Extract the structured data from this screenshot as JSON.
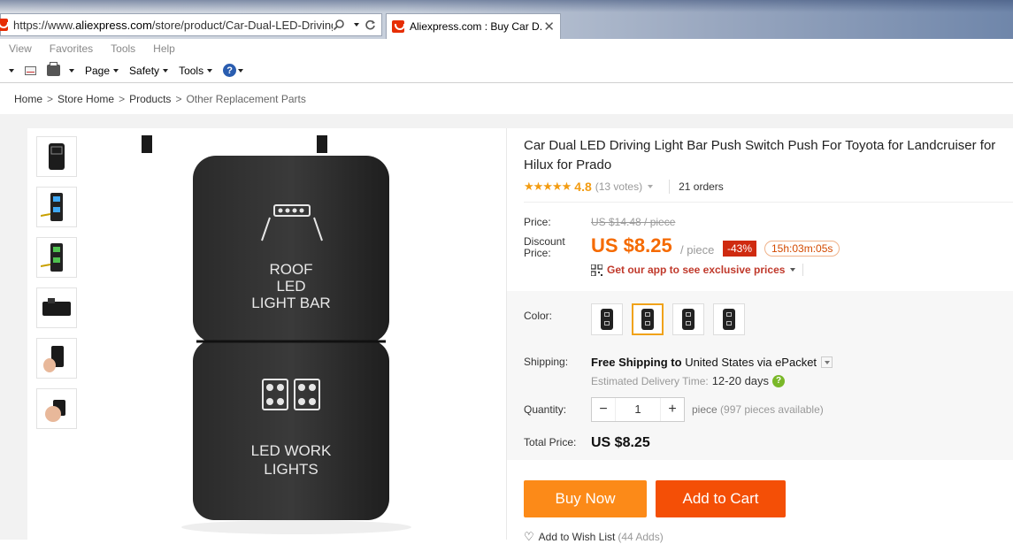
{
  "browser": {
    "url_prefix": "https://www.",
    "url_host": "aliexpress.com",
    "url_path": "/store/product/Car-Dual-LED-Driving-Li",
    "search_icon": "search-icon",
    "refresh_icon": "refresh-icon",
    "tab_title": "Aliexpress.com : Buy Car D...",
    "tab_close": "✕",
    "menu": [
      "View",
      "Favorites",
      "Tools",
      "Help"
    ],
    "toolbar": {
      "page": "Page",
      "safety": "Safety",
      "tools": "Tools",
      "help": "?"
    }
  },
  "breadcrumb": [
    "Home",
    "Store Home",
    "Products",
    "Other Replacement Parts"
  ],
  "breadcrumb_sep": ">",
  "product": {
    "title_line1": "Car Dual LED Driving Light Bar Push Switch Push For Toyota for Landcruiser for",
    "title_line2": "Hilux for Prado",
    "stars": "★★★★★",
    "rating": "4.8",
    "votes": "(13 votes)",
    "orders": "21 orders",
    "image_label_top": [
      "ROOF",
      "LED",
      "LIGHT BAR"
    ],
    "image_label_bottom": [
      "LED WORK",
      "LIGHTS"
    ]
  },
  "pricing": {
    "price_label": "Price:",
    "original_price": "US $14.48 / piece",
    "discount_label_1": "Discount",
    "discount_label_2": "Price:",
    "current_price": "US $8.25",
    "per_unit": "/ piece",
    "discount_pct": "-43%",
    "timer": "15h:03m:05s",
    "app_promo": "Get our app to see exclusive prices"
  },
  "options": {
    "color_label": "Color:",
    "selected_swatch_index": 1,
    "shipping_label": "Shipping:",
    "shipping_free": "Free Shipping to",
    "shipping_dest": "United States via ePacket",
    "est_label": "Estimated Delivery Time:",
    "est_days": "12-20 days",
    "quantity_label": "Quantity:",
    "quantity_minus": "−",
    "quantity_value": "1",
    "quantity_plus": "+",
    "quantity_piece": "piece",
    "quantity_avail": "(997 pieces available)",
    "total_label": "Total Price:",
    "total_value": "US $8.25"
  },
  "actions": {
    "buy_now": "Buy Now",
    "add_to_cart": "Add to Cart",
    "wish": "Add to Wish List",
    "wish_count": "(44 Adds)"
  },
  "colors": {
    "accent": "#f56a00",
    "buy": "#fc8a18",
    "cart": "#f44f06",
    "discount": "#cf2a10",
    "brand": "#e62e04"
  }
}
